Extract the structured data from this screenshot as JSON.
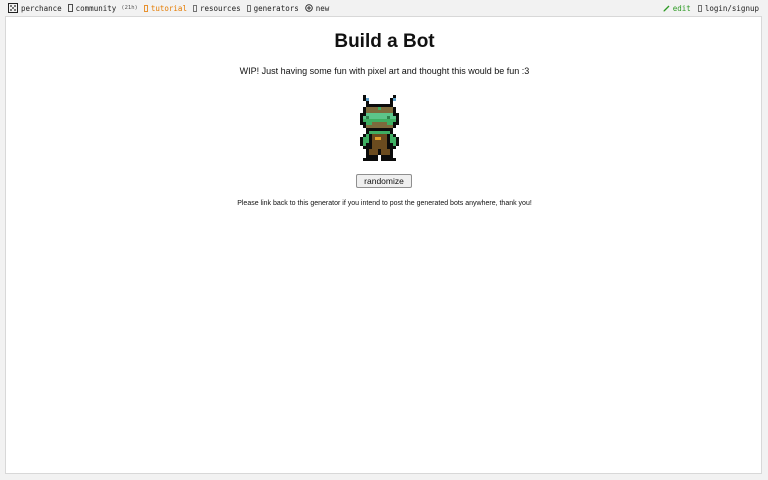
{
  "nav": {
    "brand": "perchance",
    "community": "community",
    "community_count": "(21h)",
    "tutorial": "tutorial",
    "resources": "resources",
    "generators": "generators",
    "new": "new",
    "edit": "edit",
    "login": "login/signup"
  },
  "icons": {
    "brand": "dice-icon",
    "community": "chat-icon",
    "tutorial": "book-icon",
    "resources": "folder-icon",
    "generators": "list-icon",
    "new": "plus-circle-icon",
    "edit": "pencil-icon",
    "login": "user-icon"
  },
  "colors": {
    "accent": "#e57b00",
    "edit": "#2c9a22"
  },
  "page": {
    "title": "Build a Bot",
    "subtitle": "WIP! Just having some fun with pixel art and thought this would be fun :3",
    "randomize_label": "randomize",
    "note": "Please link back to this generator if you intend to post the generated bots anywhere, thank you!"
  }
}
